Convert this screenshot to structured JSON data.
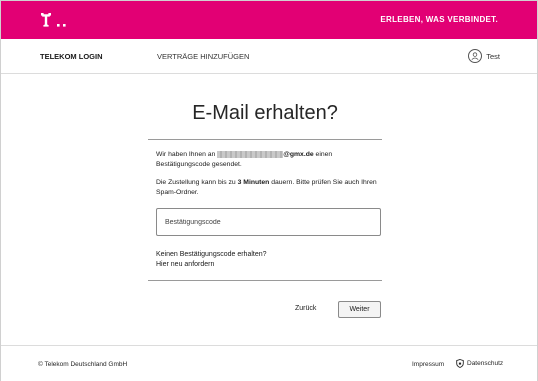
{
  "header": {
    "slogan": "ERLEBEN, WAS VERBINDET.",
    "logo_icon": "telekom-t-logo-icon",
    "brand_color": "#e20074"
  },
  "nav": {
    "login_label": "TELEKOM LOGIN",
    "add_contracts_label": "VERTRÄGE HINZUFÜGEN",
    "user_icon": "user-icon",
    "user_name": "Test"
  },
  "main": {
    "title": "E-Mail erhalten?",
    "info_prefix": "Wir haben Ihnen an",
    "email_suffix": "@gmx.de",
    "info_suffix": "einen Bestätigungscode gesendet.",
    "delivery_prefix": "Die Zustellung kann bis zu",
    "delivery_bold": "3 Minuten",
    "delivery_suffix": "dauern. Bitte prüfen Sie auch Ihren Spam-Ordner.",
    "code_placeholder": "Bestätigungscode",
    "code_value": "",
    "no_code_text": "Keinen Bestätigungscode erhalten?",
    "resend_link": "Hier neu anfordern",
    "back_label": "Zurück",
    "next_label": "Weiter"
  },
  "footer": {
    "copyright": "© Telekom Deutschland GmbH",
    "impressum": "Impressum",
    "privacy": "Datenschutz",
    "privacy_icon": "shield-icon"
  }
}
